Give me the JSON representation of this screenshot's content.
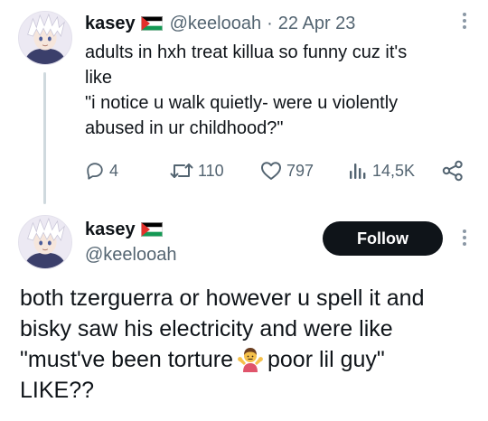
{
  "tweet1": {
    "display_name": "kasey",
    "handle": "@keelooah",
    "separator": "·",
    "date": "22 Apr 23",
    "text_lines": [
      "adults in hxh treat killua so funny cuz it's",
      "like",
      "\"i notice u walk quietly- were u violently",
      "abused in ur childhood?\""
    ],
    "actions": {
      "replies": "4",
      "retweets": "110",
      "likes": "797",
      "views": "14,5K"
    }
  },
  "tweet2": {
    "display_name": "kasey",
    "handle": "@keelooah",
    "follow_label": "Follow",
    "text_lines": [
      "both tzerguerra or however u spell it and",
      "bisky saw his electricity and were like",
      "\"must've been torture",
      "poor lil guy\"",
      "LIKE??"
    ]
  },
  "icons": {
    "flag": "palestine-flag-icon",
    "reply": "reply-icon",
    "retweet": "retweet-icon",
    "like": "heart-icon",
    "views": "views-bar-chart-icon",
    "share": "share-icon",
    "more": "more-vertical-icon",
    "emoji": "person-shrugging-emoji"
  },
  "colors": {
    "text": "#0f1419",
    "secondary": "#536471",
    "thread_line": "#cfd9de",
    "follow_button": "#0f1419"
  }
}
